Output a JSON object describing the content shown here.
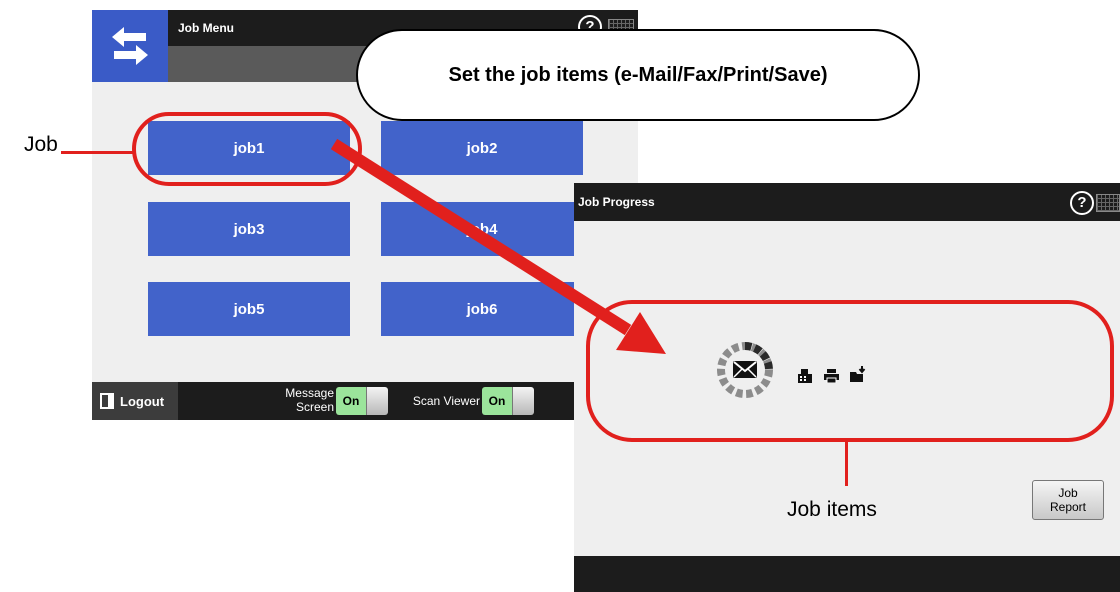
{
  "job_menu": {
    "title": "Job Menu",
    "help_glyph": "?",
    "jobs": [
      "job1",
      "job2",
      "job3",
      "job4",
      "job5",
      "job6"
    ],
    "logout_label": "Logout",
    "message_screen_label_line1": "Message",
    "message_screen_label_line2": "Screen",
    "message_screen_value": "On",
    "scan_viewer_label": "Scan Viewer",
    "scan_viewer_value": "On"
  },
  "job_progress": {
    "title": "Job Progress",
    "help_glyph": "?",
    "items": [
      {
        "icon": "email-icon",
        "active": true
      },
      {
        "icon": "fax-icon",
        "active": false
      },
      {
        "icon": "printer-icon",
        "active": false
      },
      {
        "icon": "save-folder-icon",
        "active": false
      }
    ],
    "job_report_label": "Job Report"
  },
  "annotations": {
    "bubble_text": "Set the job items (e-Mail/Fax/Print/Save)",
    "job_label": "Job",
    "job_items_label": "Job items",
    "accent_color": "#e1201d",
    "button_color": "#4263ca"
  }
}
